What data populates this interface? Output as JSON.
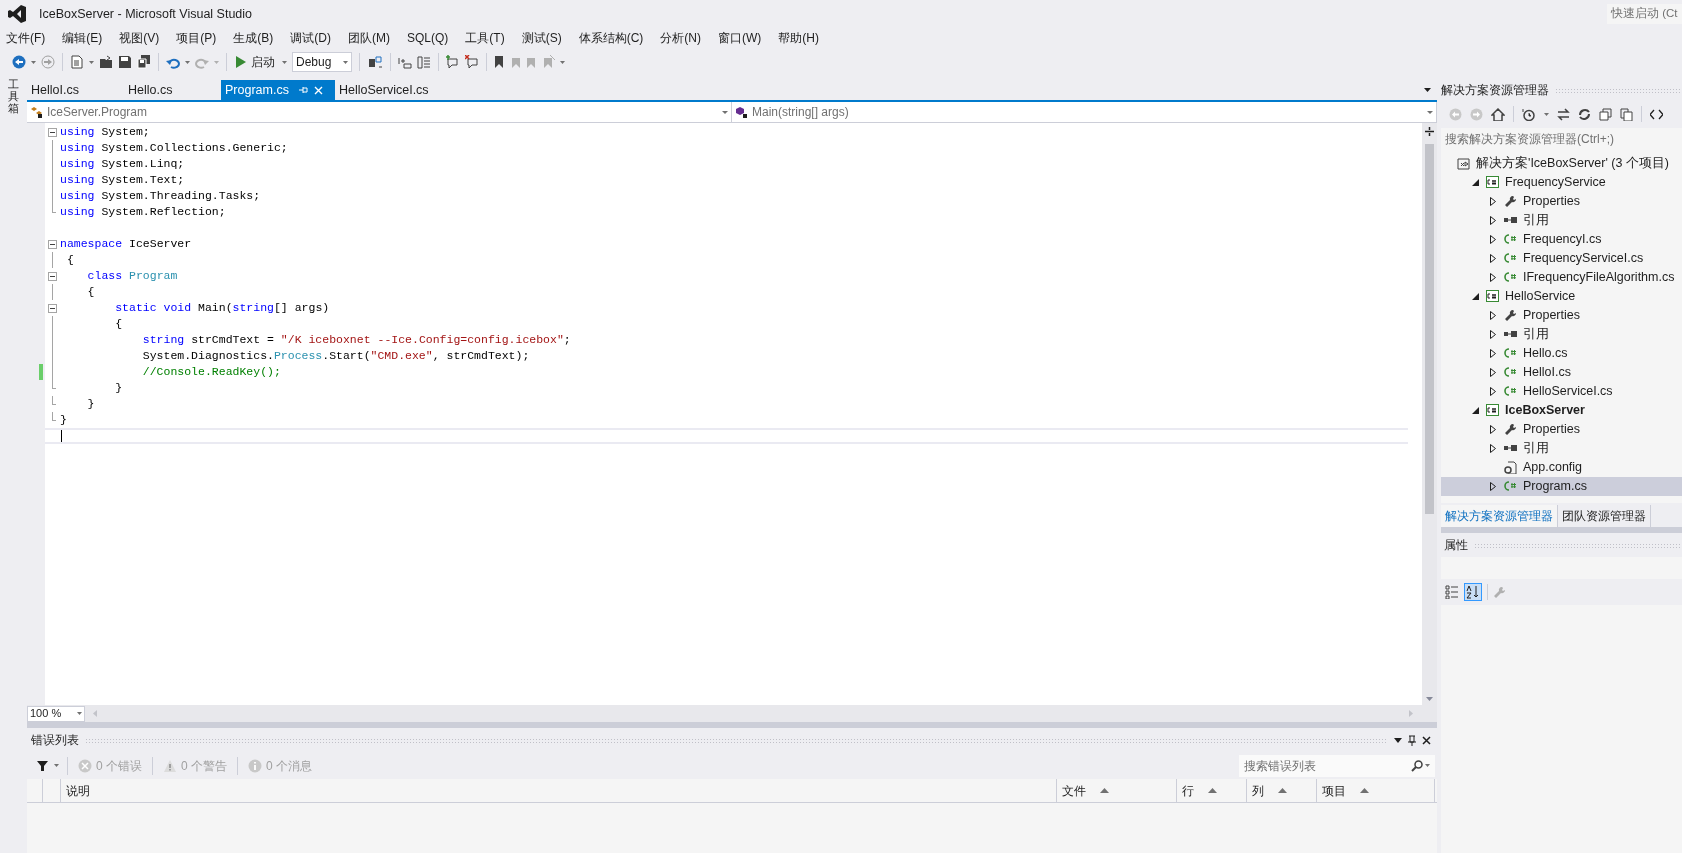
{
  "window": {
    "title": "IceBoxServer - Microsoft Visual Studio",
    "quick_launch": {
      "placeholder": "快速启动 (Ct"
    }
  },
  "menu": [
    "文件(F)",
    "编辑(E)",
    "视图(V)",
    "项目(P)",
    "生成(B)",
    "调试(D)",
    "团队(M)",
    "SQL(Q)",
    "工具(T)",
    "测试(S)",
    "体系结构(C)",
    "分析(N)",
    "窗口(W)",
    "帮助(H)"
  ],
  "toolbar": {
    "start_label": "启动",
    "configuration": "Debug"
  },
  "side_strip": {
    "label": "工具箱"
  },
  "tabs": [
    {
      "label": "HelloI.cs",
      "selected": false
    },
    {
      "label": "Hello.cs",
      "selected": false
    },
    {
      "label": "Program.cs",
      "selected": true
    },
    {
      "label": "HelloServiceI.cs",
      "selected": false
    }
  ],
  "navigation": {
    "type_dropdown": "IceServer.Program",
    "member_dropdown": "Main(string[] args)"
  },
  "code": {
    "lines": [
      {
        "collapsible": true,
        "in_block": false,
        "block_end": false,
        "changed": false,
        "current": false,
        "tokens": [
          {
            "text": "using",
            "kind": "keyword"
          },
          {
            "text": " System;",
            "kind": "plain"
          }
        ]
      },
      {
        "collapsible": false,
        "in_block": true,
        "block_end": false,
        "changed": false,
        "current": false,
        "tokens": [
          {
            "text": "using",
            "kind": "keyword"
          },
          {
            "text": " System.Collections.Generic;",
            "kind": "plain"
          }
        ]
      },
      {
        "collapsible": false,
        "in_block": true,
        "block_end": false,
        "changed": false,
        "current": false,
        "tokens": [
          {
            "text": "using",
            "kind": "keyword"
          },
          {
            "text": " System.Linq;",
            "kind": "plain"
          }
        ]
      },
      {
        "collapsible": false,
        "in_block": true,
        "block_end": false,
        "changed": false,
        "current": false,
        "tokens": [
          {
            "text": "using",
            "kind": "keyword"
          },
          {
            "text": " System.Text;",
            "kind": "plain"
          }
        ]
      },
      {
        "collapsible": false,
        "in_block": true,
        "block_end": false,
        "changed": false,
        "current": false,
        "tokens": [
          {
            "text": "using",
            "kind": "keyword"
          },
          {
            "text": " System.Threading.Tasks;",
            "kind": "plain"
          }
        ]
      },
      {
        "collapsible": false,
        "in_block": false,
        "block_end": true,
        "changed": false,
        "current": false,
        "tokens": [
          {
            "text": "using",
            "kind": "keyword"
          },
          {
            "text": " System.Reflection;",
            "kind": "plain"
          }
        ]
      },
      {
        "collapsible": false,
        "in_block": false,
        "block_end": false,
        "changed": false,
        "current": false
      },
      {
        "collapsible": true,
        "in_block": false,
        "block_end": false,
        "changed": false,
        "current": false,
        "tokens": [
          {
            "text": "namespace",
            "kind": "keyword"
          },
          {
            "text": " IceServer",
            "kind": "plain"
          }
        ]
      },
      {
        "collapsible": false,
        "in_block": true,
        "block_end": false,
        "changed": false,
        "current": false,
        "tokens": [
          {
            "text": " {",
            "kind": "plain"
          }
        ]
      },
      {
        "collapsible": true,
        "in_block": false,
        "block_end": false,
        "changed": false,
        "current": false,
        "tokens": [
          {
            "text": "    class",
            "kind": "keyword"
          },
          {
            "text": " Program",
            "kind": "type"
          }
        ]
      },
      {
        "collapsible": false,
        "in_block": true,
        "block_end": false,
        "changed": false,
        "current": false,
        "tokens": [
          {
            "text": "    {",
            "kind": "plain"
          }
        ]
      },
      {
        "collapsible": true,
        "in_block": false,
        "block_end": false,
        "changed": false,
        "current": false,
        "tokens": [
          {
            "text": "        static void",
            "kind": "keyword"
          },
          {
            "text": " Main(",
            "kind": "plain"
          },
          {
            "text": "string",
            "kind": "keyword"
          },
          {
            "text": "[] args)",
            "kind": "plain"
          }
        ]
      },
      {
        "collapsible": false,
        "in_block": true,
        "block_end": false,
        "changed": false,
        "current": false,
        "tokens": [
          {
            "text": "        {",
            "kind": "plain"
          }
        ]
      },
      {
        "collapsible": false,
        "in_block": true,
        "block_end": false,
        "changed": false,
        "current": false,
        "tokens": [
          {
            "text": "            string",
            "kind": "keyword"
          },
          {
            "text": " strCmdText = ",
            "kind": "plain"
          },
          {
            "text": "\"/K iceboxnet --Ice.Config=config.icebox\"",
            "kind": "string"
          },
          {
            "text": ";",
            "kind": "plain"
          }
        ]
      },
      {
        "collapsible": false,
        "in_block": true,
        "block_end": false,
        "changed": false,
        "current": false,
        "tokens": [
          {
            "text": "            System.Diagnostics.",
            "kind": "plain"
          },
          {
            "text": "Process",
            "kind": "type"
          },
          {
            "text": ".Start(",
            "kind": "plain"
          },
          {
            "text": "\"CMD.exe\"",
            "kind": "string"
          },
          {
            "text": ", strCmdText);",
            "kind": "plain"
          }
        ]
      },
      {
        "collapsible": false,
        "in_block": true,
        "block_end": false,
        "changed": true,
        "current": false,
        "tokens": [
          {
            "text": "            //Console.ReadKey();",
            "kind": "comment"
          }
        ]
      },
      {
        "collapsible": false,
        "in_block": false,
        "block_end": true,
        "changed": false,
        "current": false,
        "tokens": [
          {
            "text": "        }",
            "kind": "plain"
          }
        ]
      },
      {
        "collapsible": false,
        "in_block": false,
        "block_end": true,
        "changed": false,
        "current": false,
        "tokens": [
          {
            "text": "    }",
            "kind": "plain"
          }
        ]
      },
      {
        "collapsible": false,
        "in_block": false,
        "block_end": true,
        "changed": false,
        "current": false,
        "tokens": [
          {
            "text": "}",
            "kind": "plain"
          }
        ]
      },
      {
        "collapsible": false,
        "in_block": false,
        "block_end": false,
        "changed": false,
        "current": true
      }
    ]
  },
  "zoom": "100 %",
  "error_list": {
    "title": "错误列表",
    "filters": [
      "0 个错误",
      "0 个警告",
      "0 个消息"
    ],
    "search": {
      "placeholder": "搜索错误列表"
    },
    "columns": [
      {
        "label": "说明",
        "sorted": false
      },
      {
        "label": "文件",
        "sorted": true
      },
      {
        "label": "行",
        "sorted": true
      },
      {
        "label": "列",
        "sorted": true
      },
      {
        "label": "项目",
        "sorted": true
      }
    ]
  },
  "solution_explorer": {
    "title": "解决方案资源管理器",
    "search": {
      "placeholder": "搜索解决方案资源管理器(Ctrl+;)"
    },
    "tree": [
      {
        "label": "解决方案'IceBoxServer' (3 个项目)",
        "kind": "solution",
        "selected": false,
        "children": [
          {
            "label": "FrequencyService",
            "kind": "project",
            "expanded": true,
            "startup": false,
            "selected": false,
            "children": [
              {
                "label": "Properties",
                "kind": "properties",
                "expanded": false,
                "selected": false
              },
              {
                "label": "引用",
                "kind": "references",
                "expanded": false,
                "selected": false
              },
              {
                "label": "FrequencyI.cs",
                "kind": "csharp",
                "expanded": false,
                "selected": false
              },
              {
                "label": "FrequencyServiceI.cs",
                "kind": "csharp",
                "expanded": false,
                "selected": false
              },
              {
                "label": "IFrequencyFileAlgorithm.cs",
                "kind": "csharp",
                "expanded": false,
                "selected": false
              }
            ]
          },
          {
            "label": "HelloService",
            "kind": "project",
            "expanded": true,
            "startup": false,
            "selected": false,
            "children": [
              {
                "label": "Properties",
                "kind": "properties",
                "expanded": false,
                "selected": false
              },
              {
                "label": "引用",
                "kind": "references",
                "expanded": false,
                "selected": false
              },
              {
                "label": "Hello.cs",
                "kind": "csharp",
                "expanded": false,
                "selected": false
              },
              {
                "label": "HelloI.cs",
                "kind": "csharp",
                "expanded": false,
                "selected": false
              },
              {
                "label": "HelloServiceI.cs",
                "kind": "csharp",
                "expanded": false,
                "selected": false
              }
            ]
          },
          {
            "label": "IceBoxServer",
            "kind": "project",
            "expanded": true,
            "startup": true,
            "selected": false,
            "children": [
              {
                "label": "Properties",
                "kind": "properties",
                "expanded": false,
                "selected": false
              },
              {
                "label": "引用",
                "kind": "references",
                "expanded": false,
                "selected": false
              },
              {
                "label": "App.config",
                "kind": "config",
                "selected": false
              },
              {
                "label": "Program.cs",
                "kind": "csharp",
                "expanded": false,
                "selected": true
              }
            ]
          }
        ]
      }
    ],
    "bottom_tabs": [
      {
        "label": "解决方案资源管理器",
        "selected": true
      },
      {
        "label": "团队资源管理器",
        "selected": false
      }
    ]
  },
  "properties": {
    "title": "属性"
  }
}
